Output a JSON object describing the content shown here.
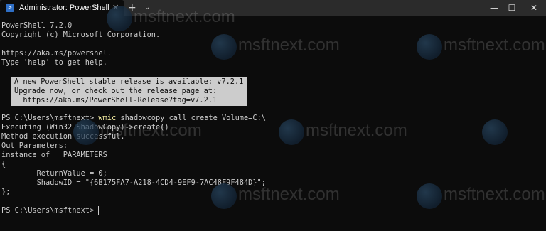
{
  "window": {
    "tab_title": "Administrator: PowerShell",
    "tab_close_glyph": "✕",
    "new_tab_glyph": "+",
    "dropdown_glyph": "⌄",
    "minimize_glyph": "—",
    "maximize_glyph": "☐",
    "close_glyph": "✕",
    "tab_icon_name": "powershell-icon",
    "tab_icon_glyph": ">"
  },
  "terminal": {
    "lines": [
      "PowerShell 7.2.0",
      "Copyright (c) Microsoft Corporation.",
      "",
      "https://aka.ms/powershell",
      "Type 'help' to get help.",
      "",
      "PS C:\\Users\\msftnext> ",
      "Executing (Win32_ShadowCopy)->create()",
      "Method execution successful.",
      "Out Parameters:",
      "instance of __PARAMETERS",
      "{",
      "        ReturnValue = 0;",
      "        ShadowID = \"{6B175FA7-A218-4CD4-9EF9-7AC48F9F484D}\";",
      "};",
      "",
      "PS C:\\Users\\msftnext> "
    ],
    "notice": [
      "A new PowerShell stable release is available: v7.2.1",
      "Upgrade now, or check out the release page at:",
      "  https://aka.ms/PowerShell-Release?tag=v7.2.1"
    ],
    "command_word": "wmic",
    "command_args": " shadowcopy call create Volume=C:\\"
  },
  "watermark": {
    "text": "msftnext.com"
  },
  "colors": {
    "background": "#0c0c0c",
    "foreground": "#cccccc",
    "command_highlight": "#f9f1a5",
    "titlebar": "#2b2b2b"
  }
}
